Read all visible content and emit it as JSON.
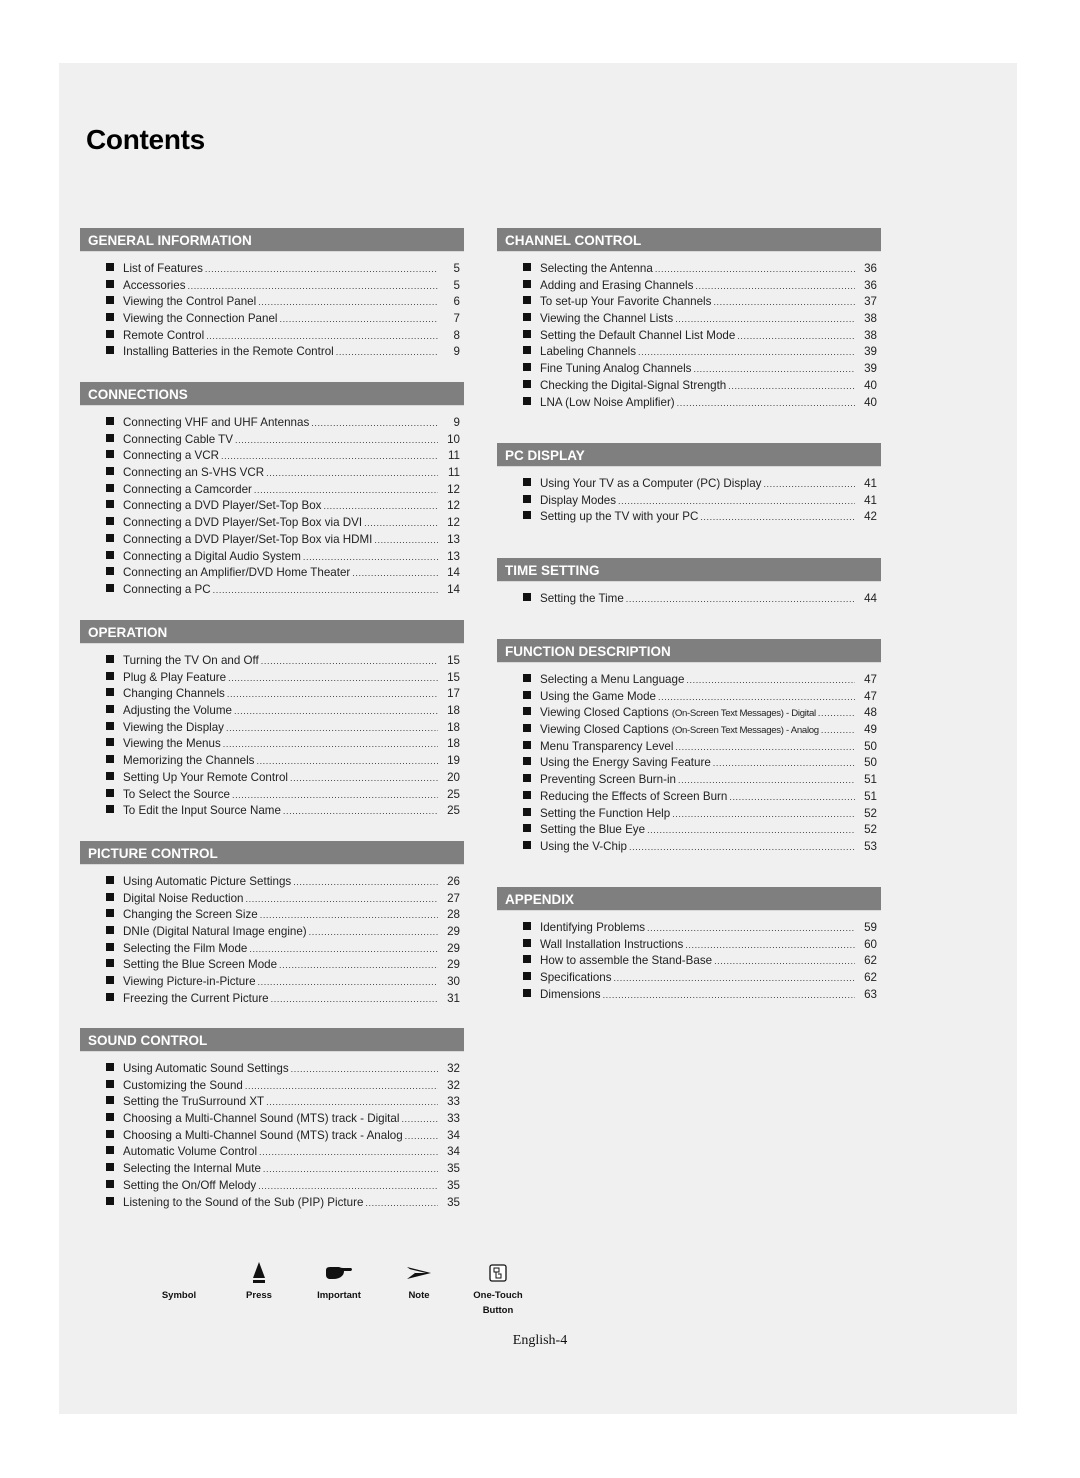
{
  "title": "Contents",
  "left_sections": [
    {
      "heading": "GENERAL INFORMATION",
      "items": [
        {
          "label": "List of Features",
          "page": "5"
        },
        {
          "label": "Accessories",
          "page": "5"
        },
        {
          "label": "Viewing the Control Panel",
          "page": "6"
        },
        {
          "label": "Viewing the Connection Panel",
          "page": "7"
        },
        {
          "label": "Remote Control",
          "page": "8"
        },
        {
          "label": "Installing Batteries in the Remote Control",
          "page": "9"
        }
      ]
    },
    {
      "heading": "CONNECTIONS",
      "items": [
        {
          "label": "Connecting VHF and UHF Antennas",
          "page": "9"
        },
        {
          "label": "Connecting Cable TV",
          "page": "10"
        },
        {
          "label": "Connecting a VCR",
          "page": "11"
        },
        {
          "label": "Connecting an S-VHS VCR",
          "page": "11"
        },
        {
          "label": "Connecting a Camcorder",
          "page": "12"
        },
        {
          "label": "Connecting a DVD Player/Set-Top Box",
          "page": "12"
        },
        {
          "label": "Connecting a DVD Player/Set-Top Box via DVI",
          "page": "12"
        },
        {
          "label": "Connecting a DVD Player/Set-Top Box via HDMI",
          "page": "13"
        },
        {
          "label": "Connecting a Digital Audio System",
          "page": "13"
        },
        {
          "label": "Connecting an Amplifier/DVD Home Theater",
          "page": "14"
        },
        {
          "label": "Connecting a PC",
          "page": "14"
        }
      ]
    },
    {
      "heading": "OPERATION",
      "items": [
        {
          "label": "Turning the TV On and Off",
          "page": "15"
        },
        {
          "label": "Plug & Play Feature",
          "page": "15"
        },
        {
          "label": "Changing Channels",
          "page": "17"
        },
        {
          "label": "Adjusting the Volume",
          "page": "18"
        },
        {
          "label": "Viewing the Display",
          "page": "18"
        },
        {
          "label": "Viewing the Menus",
          "page": "18"
        },
        {
          "label": "Memorizing the Channels",
          "page": "19"
        },
        {
          "label": "Setting Up Your Remote Control",
          "page": "20"
        },
        {
          "label": "To Select the Source",
          "page": "25"
        },
        {
          "label": "To Edit the Input Source Name",
          "page": "25"
        }
      ]
    },
    {
      "heading": "PICTURE CONTROL",
      "items": [
        {
          "label": "Using Automatic Picture Settings",
          "page": "26"
        },
        {
          "label": "Digital Noise Reduction",
          "page": "27"
        },
        {
          "label": "Changing the Screen Size",
          "page": "28"
        },
        {
          "label": "DNIe (Digital Natural Image engine)",
          "page": "29"
        },
        {
          "label": "Selecting the Film Mode",
          "page": "29"
        },
        {
          "label": "Setting the Blue Screen Mode",
          "page": "29"
        },
        {
          "label": "Viewing Picture-in-Picture",
          "page": "30"
        },
        {
          "label": "Freezing the Current Picture",
          "page": "31"
        }
      ]
    },
    {
      "heading": "SOUND CONTROL",
      "items": [
        {
          "label": "Using Automatic Sound Settings",
          "page": "32"
        },
        {
          "label": "Customizing the Sound",
          "page": "32"
        },
        {
          "label": "Setting the TruSurround XT",
          "page": "33"
        },
        {
          "label": "Choosing a Multi-Channel Sound (MTS) track - Digital",
          "page": "33"
        },
        {
          "label": "Choosing a Multi-Channel Sound (MTS) track - Analog",
          "page": "34"
        },
        {
          "label": "Automatic Volume Control",
          "page": "34"
        },
        {
          "label": "Selecting the Internal Mute",
          "page": "35"
        },
        {
          "label": "Setting the On/Off Melody",
          "page": "35"
        },
        {
          "label": "Listening to the Sound of the Sub (PIP) Picture",
          "page": "35"
        }
      ]
    }
  ],
  "right_sections": [
    {
      "heading": "CHANNEL CONTROL",
      "items": [
        {
          "label": "Selecting the Antenna",
          "page": "36"
        },
        {
          "label": "Adding and Erasing Channels",
          "page": "36"
        },
        {
          "label": "To set-up Your Favorite Channels",
          "page": "37"
        },
        {
          "label": "Viewing the Channel Lists",
          "page": "38"
        },
        {
          "label": "Setting the Default Channel List Mode",
          "page": "38"
        },
        {
          "label": "Labeling Channels",
          "page": "39"
        },
        {
          "label": "Fine Tuning Analog Channels",
          "page": "39"
        },
        {
          "label": "Checking the Digital-Signal Strength",
          "page": "40"
        },
        {
          "label": "LNA (Low Noise Amplifier)",
          "page": "40"
        }
      ]
    },
    {
      "heading": "PC DISPLAY",
      "items": [
        {
          "label": "Using Your TV as a Computer (PC) Display",
          "page": "41"
        },
        {
          "label": "Display Modes",
          "page": "41"
        },
        {
          "label": "Setting up the TV with your PC",
          "page": "42"
        }
      ]
    },
    {
      "heading": "TIME SETTING",
      "items": [
        {
          "label": "Setting the Time",
          "page": "44"
        }
      ]
    },
    {
      "heading": "FUNCTION DESCRIPTION",
      "items": [
        {
          "label": "Selecting a Menu Language",
          "page": "47"
        },
        {
          "label": "Using the Game Mode",
          "page": "47"
        },
        {
          "label": "Viewing Closed Captions",
          "small": "(On-Screen Text Messages) - Digital",
          "page": "48"
        },
        {
          "label": "Viewing Closed Captions",
          "small": "(On-Screen Text Messages) - Analog",
          "page": "49"
        },
        {
          "label": "Menu Transparency Level",
          "page": "50"
        },
        {
          "label": "Using the Energy Saving Feature",
          "page": "50"
        },
        {
          "label": "Preventing Screen Burn-in",
          "page": "51"
        },
        {
          "label": "Reducing the Effects of Screen Burn",
          "page": "51"
        },
        {
          "label": "Setting the Function Help",
          "page": "52"
        },
        {
          "label": "Setting the Blue Eye",
          "page": "52"
        },
        {
          "label": "Using the V-Chip",
          "page": "53"
        }
      ]
    },
    {
      "heading": "APPENDIX",
      "items": [
        {
          "label": "Identifying Problems",
          "page": "59"
        },
        {
          "label": "Wall Installation Instructions",
          "page": "60"
        },
        {
          "label": "How to assemble the Stand-Base",
          "page": "62"
        },
        {
          "label": "Specifications",
          "page": "62"
        },
        {
          "label": "Dimensions",
          "page": "63"
        }
      ]
    }
  ],
  "legend": {
    "symbol_label": "Symbol",
    "items": [
      {
        "icon": "press-icon",
        "label": "Press"
      },
      {
        "icon": "pointing-hand-icon",
        "label": "Important"
      },
      {
        "icon": "arrow-note-icon",
        "label": "Note"
      },
      {
        "icon": "one-touch-button-icon",
        "label": "One-Touch Button"
      }
    ]
  },
  "footer": {
    "page_label": "English-4"
  },
  "colors": {
    "header_bar": "#7f7f7f",
    "page_bg": "#f0f0f0",
    "outer_bg": "#ffffff"
  }
}
